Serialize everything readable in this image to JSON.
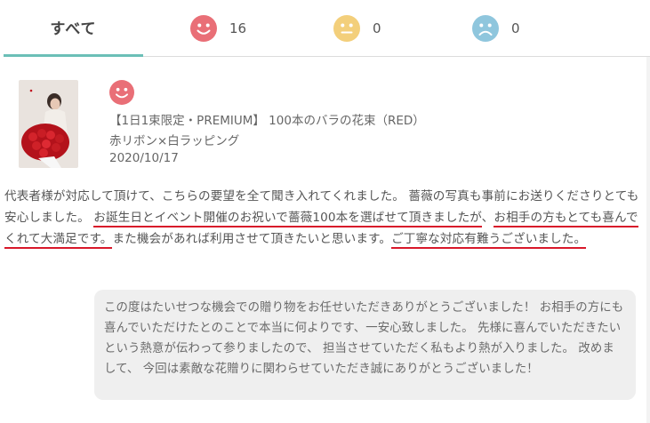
{
  "tabs": {
    "all_label": "すべて",
    "good_count": "16",
    "neutral_count": "0",
    "bad_count": "0"
  },
  "colors": {
    "good": "#e96f77",
    "neutral": "#f3cf7b",
    "bad": "#8fc6dd",
    "active_tab": "#6bbfb7",
    "highlight": "#d8182a"
  },
  "review": {
    "rating_icon": "smile-face-icon",
    "product_name": "【1日1束限定・PREMIUM】 100本のバラの花束（RED）",
    "option": "赤リボン×白ラッピング",
    "date": "2020/10/17",
    "text_parts": {
      "p1": "代表者様が対応して頂けて、こちらの要望を全て聞き入れてくれました。 薔薇の写真も事前にお送りくださりとても安心しました。 ",
      "h1": "お誕生日とイベント開催のお祝いで薔薇100本を選ばせて頂きましたが",
      "p2": "、",
      "h2": "お相手の方もとても喜んでくれて大満足です。",
      "p3": "また機会があれば利用させて頂きたいと思います。",
      "h3": "ご丁寧な対応有難うございました。"
    }
  },
  "reply": {
    "text": "この度はたいせつな機会での贈り物をお任せいただきありがとうございました！ お相手の方にも喜んでいただけたとのことで本当に何よりです、一安心致しました。 先様に喜んでいただきたいという熱意が伝わって参りましたので、 担当させていただく私もより熱が入りました。 改めまして、 今回は素敵な花贈りに関わらせていただき誠にありがとうございました！"
  }
}
